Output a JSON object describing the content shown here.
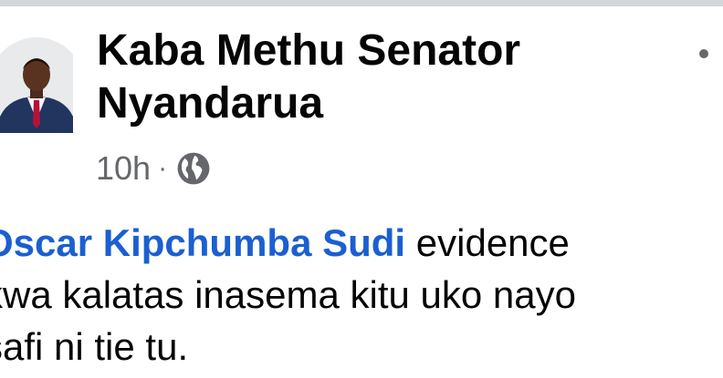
{
  "post": {
    "author": "Kaba Methu Senator Nyandarua",
    "time": "10h",
    "separator": "·",
    "privacy_icon": "globe-icon",
    "menu_icon": "more-options-icon",
    "body": {
      "mention": "Oscar Kipchumba Sudi",
      "line1_rest": " evidence",
      "line2": "kwa kalatas inasema kitu uko nayo",
      "line3": "safi ni tie tu."
    }
  },
  "colors": {
    "text": "#050505",
    "secondary": "#65676b",
    "mention": "#1b5fd1"
  }
}
